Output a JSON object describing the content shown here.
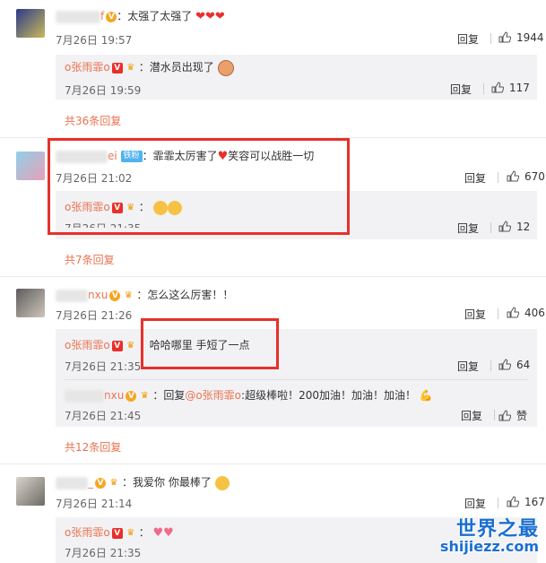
{
  "comments": [
    {
      "user_suffix": "f",
      "text": "太强了太强了",
      "time": "7月26日 19:57",
      "reply_label": "回复",
      "likes": "1944",
      "replies": [
        {
          "user": "o张雨霏o",
          "text": "潜水员出现了",
          "time": "7月26日 19:59",
          "reply_label": "回复",
          "likes": "117"
        }
      ],
      "more": "共36条回复"
    },
    {
      "user_suffix": "ei",
      "badge": "铁粉",
      "text": "霏霏太厉害了",
      "text2": "笑容可以战胜一切",
      "time": "7月26日 21:02",
      "reply_label": "回复",
      "likes": "670",
      "replies": [
        {
          "user": "o张雨霏o",
          "text": "",
          "time": "7月26日 21:35",
          "reply_label": "回复",
          "likes": "12"
        }
      ],
      "more": "共7条回复"
    },
    {
      "user_suffix": "nxu",
      "text": "怎么这么厉害！！",
      "time": "7月26日 21:26",
      "reply_label": "回复",
      "likes": "406",
      "replies": [
        {
          "user": "o张雨霏o",
          "text": "哈哈哪里 手短了一点",
          "time": "7月26日 21:35",
          "reply_label": "回复",
          "likes": "64"
        },
        {
          "user_suffix": "nxu",
          "reply_prefix": "回复",
          "mention": "@o张雨霏o",
          "text": ":超级棒啦！200加油！加油！加油！",
          "time": "7月26日 21:45",
          "reply_label": "回复",
          "likes": "赞"
        }
      ],
      "more": "共12条回复"
    },
    {
      "user_suffix": "_",
      "text": "我爱你 你最棒了",
      "time": "7月26日 21:14",
      "reply_label": "回复",
      "likes": "167",
      "replies": [
        {
          "user": "o张雨霏o",
          "text": "",
          "time": "7月26日 21:35"
        }
      ]
    }
  ],
  "watermark": {
    "line1": "世界之最",
    "line2": "shijiezz.com"
  },
  "colors": {
    "username": "#eb7350",
    "highlight": "#e8302b",
    "reply_bg": "#f2f2f5"
  }
}
